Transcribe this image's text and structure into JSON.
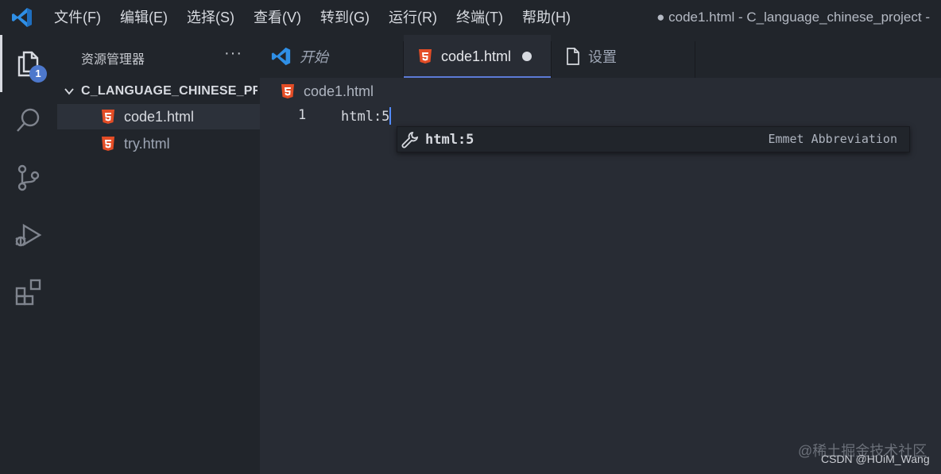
{
  "menu": [
    "文件(F)",
    "编辑(E)",
    "选择(S)",
    "查看(V)",
    "转到(G)",
    "运行(R)",
    "终端(T)",
    "帮助(H)"
  ],
  "window_title": "● code1.html - C_language_chinese_project -",
  "activity": {
    "explorer_badge": "1"
  },
  "sidebar": {
    "title": "资源管理器",
    "more": "···",
    "folder": "C_LANGUAGE_CHINESE_PR...",
    "files": [
      {
        "name": "code1.html",
        "selected": true
      },
      {
        "name": "try.html",
        "selected": false
      }
    ]
  },
  "tabs": [
    {
      "label": "开始"
    },
    {
      "label": "code1.html"
    },
    {
      "label": "设置"
    }
  ],
  "breadcrumb": "code1.html",
  "editor": {
    "line_number": "1",
    "code": "html:5"
  },
  "suggest": {
    "label": "html:5",
    "detail": "Emmet Abbreviation"
  },
  "watermark": {
    "line1": "@稀土掘金技术社区",
    "line2": "CSDN @HUiM_Wang"
  },
  "colors": {
    "accent": "#5c7ad6",
    "badge": "#4d78cc",
    "html_icon": "#e44d26",
    "vscode_blue": "#2f8fe6"
  }
}
